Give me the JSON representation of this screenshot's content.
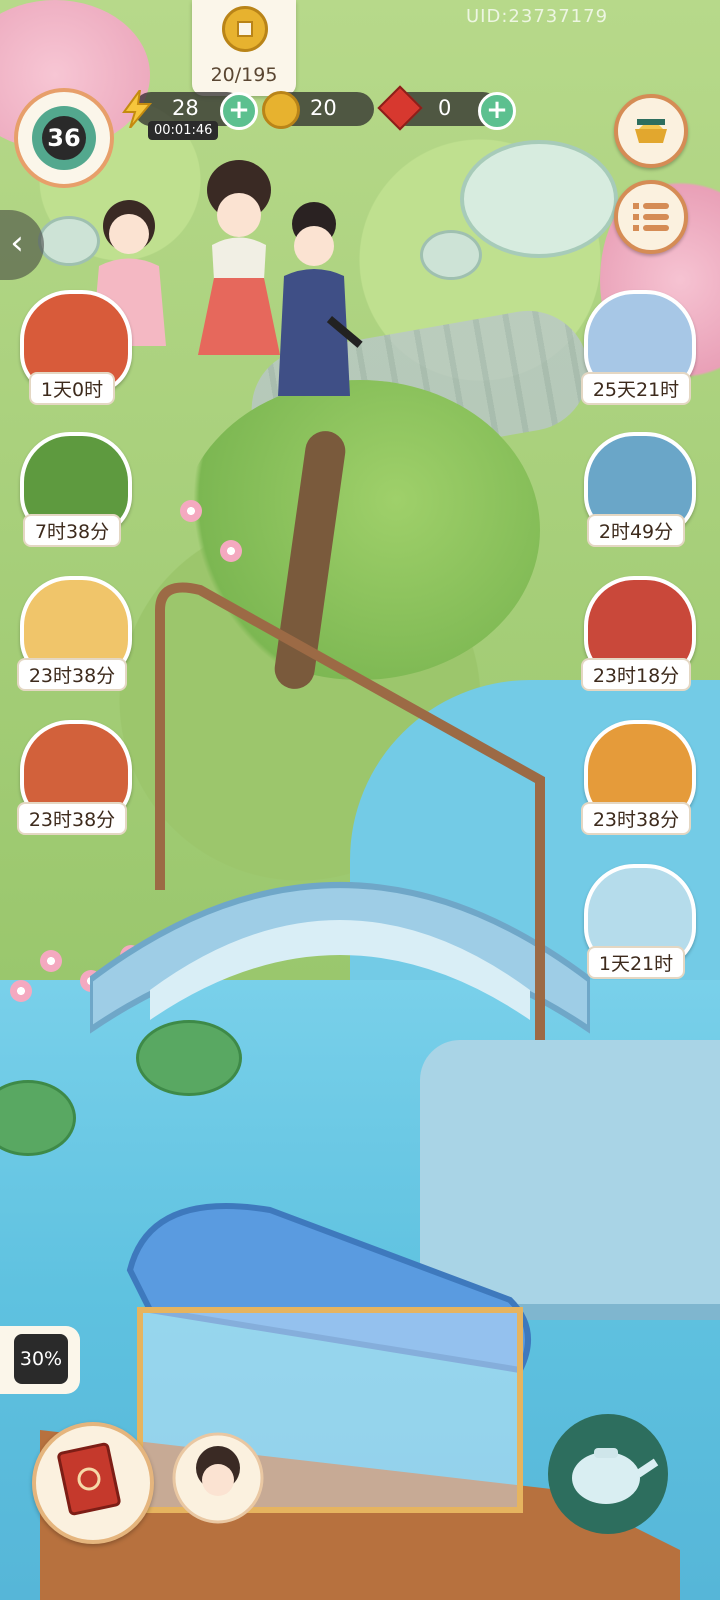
{
  "header": {
    "uid_text": "UID:23737179",
    "coin_progress": "20/195",
    "level": "36",
    "energy": {
      "value": "28",
      "timer": "00:01:46"
    },
    "coins": {
      "value": "20"
    },
    "gems": {
      "value": "0"
    }
  },
  "side_events_left": [
    {
      "icon": "scroll-book-icon",
      "label": "1天0时",
      "color": "#d85b3a"
    },
    {
      "icon": "vegetable-basket-icon",
      "label": "7时38分",
      "color": "#5e9a3f"
    },
    {
      "icon": "fox-icon",
      "label": "23时38分",
      "color": "#f0c56a"
    },
    {
      "icon": "cat-drum-icon",
      "label": "23时38分",
      "color": "#d2613b"
    }
  ],
  "side_events_right": [
    {
      "icon": "snow-cat-icon",
      "label": "25天21时",
      "color": "#a7c7e6"
    },
    {
      "icon": "snow-chest-icon",
      "label": "2时49分",
      "color": "#6aa6c8"
    },
    {
      "icon": "plus-one-sign-icon",
      "label": "23时18分",
      "color": "#c9483a"
    },
    {
      "icon": "gold-coins-board-icon",
      "label": "23时38分",
      "color": "#e59b3a"
    },
    {
      "icon": "ice-gift-cat-icon",
      "label": "1天21时",
      "color": "#b5dceb"
    }
  ],
  "bottom": {
    "progress_label": "30%"
  },
  "colors": {
    "plus_green": "#5cc08f",
    "accent_orange": "#d58c55"
  }
}
